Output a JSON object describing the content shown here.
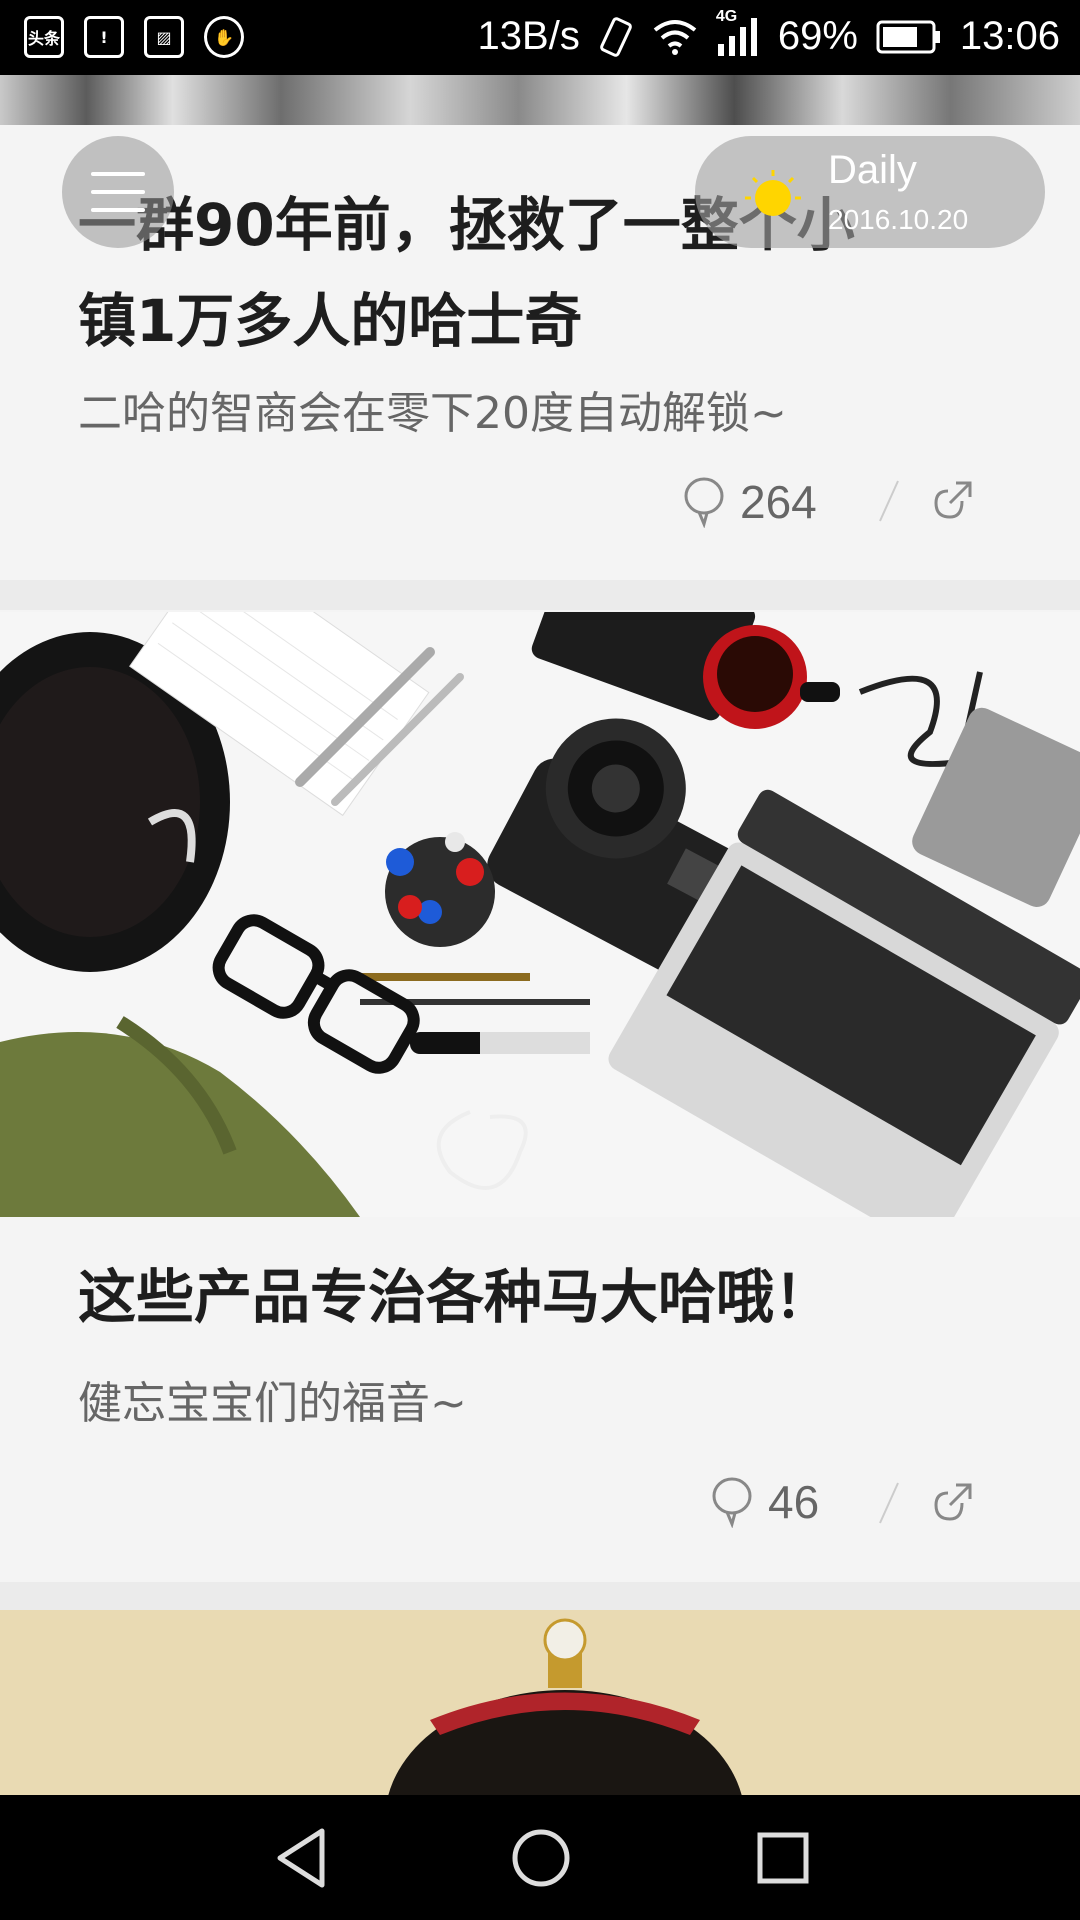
{
  "status_bar": {
    "left_icons": [
      "头条",
      "battery-alert-icon",
      "image-icon",
      "hand-icon"
    ],
    "net_speed": "13B/s",
    "network_label": "4G",
    "battery": "69%",
    "time": "13:06"
  },
  "floating": {
    "daily_label": "Daily",
    "daily_date": "2016.10.20"
  },
  "articles": [
    {
      "title_line1": "一群90年前，拯救了一整个小",
      "title_line2": "镇1万多人的哈士奇",
      "subtitle": "二哈的智商会在零下20度自动解锁~",
      "comments": "264"
    },
    {
      "title": "这些产品专治各种马大哈哦！",
      "subtitle": "健忘宝宝们的福音~",
      "comments": "46"
    }
  ],
  "colors": {
    "status_bar_bg": "#000000",
    "card_bg": "#f4f4f4",
    "sun": "#ffd500"
  }
}
